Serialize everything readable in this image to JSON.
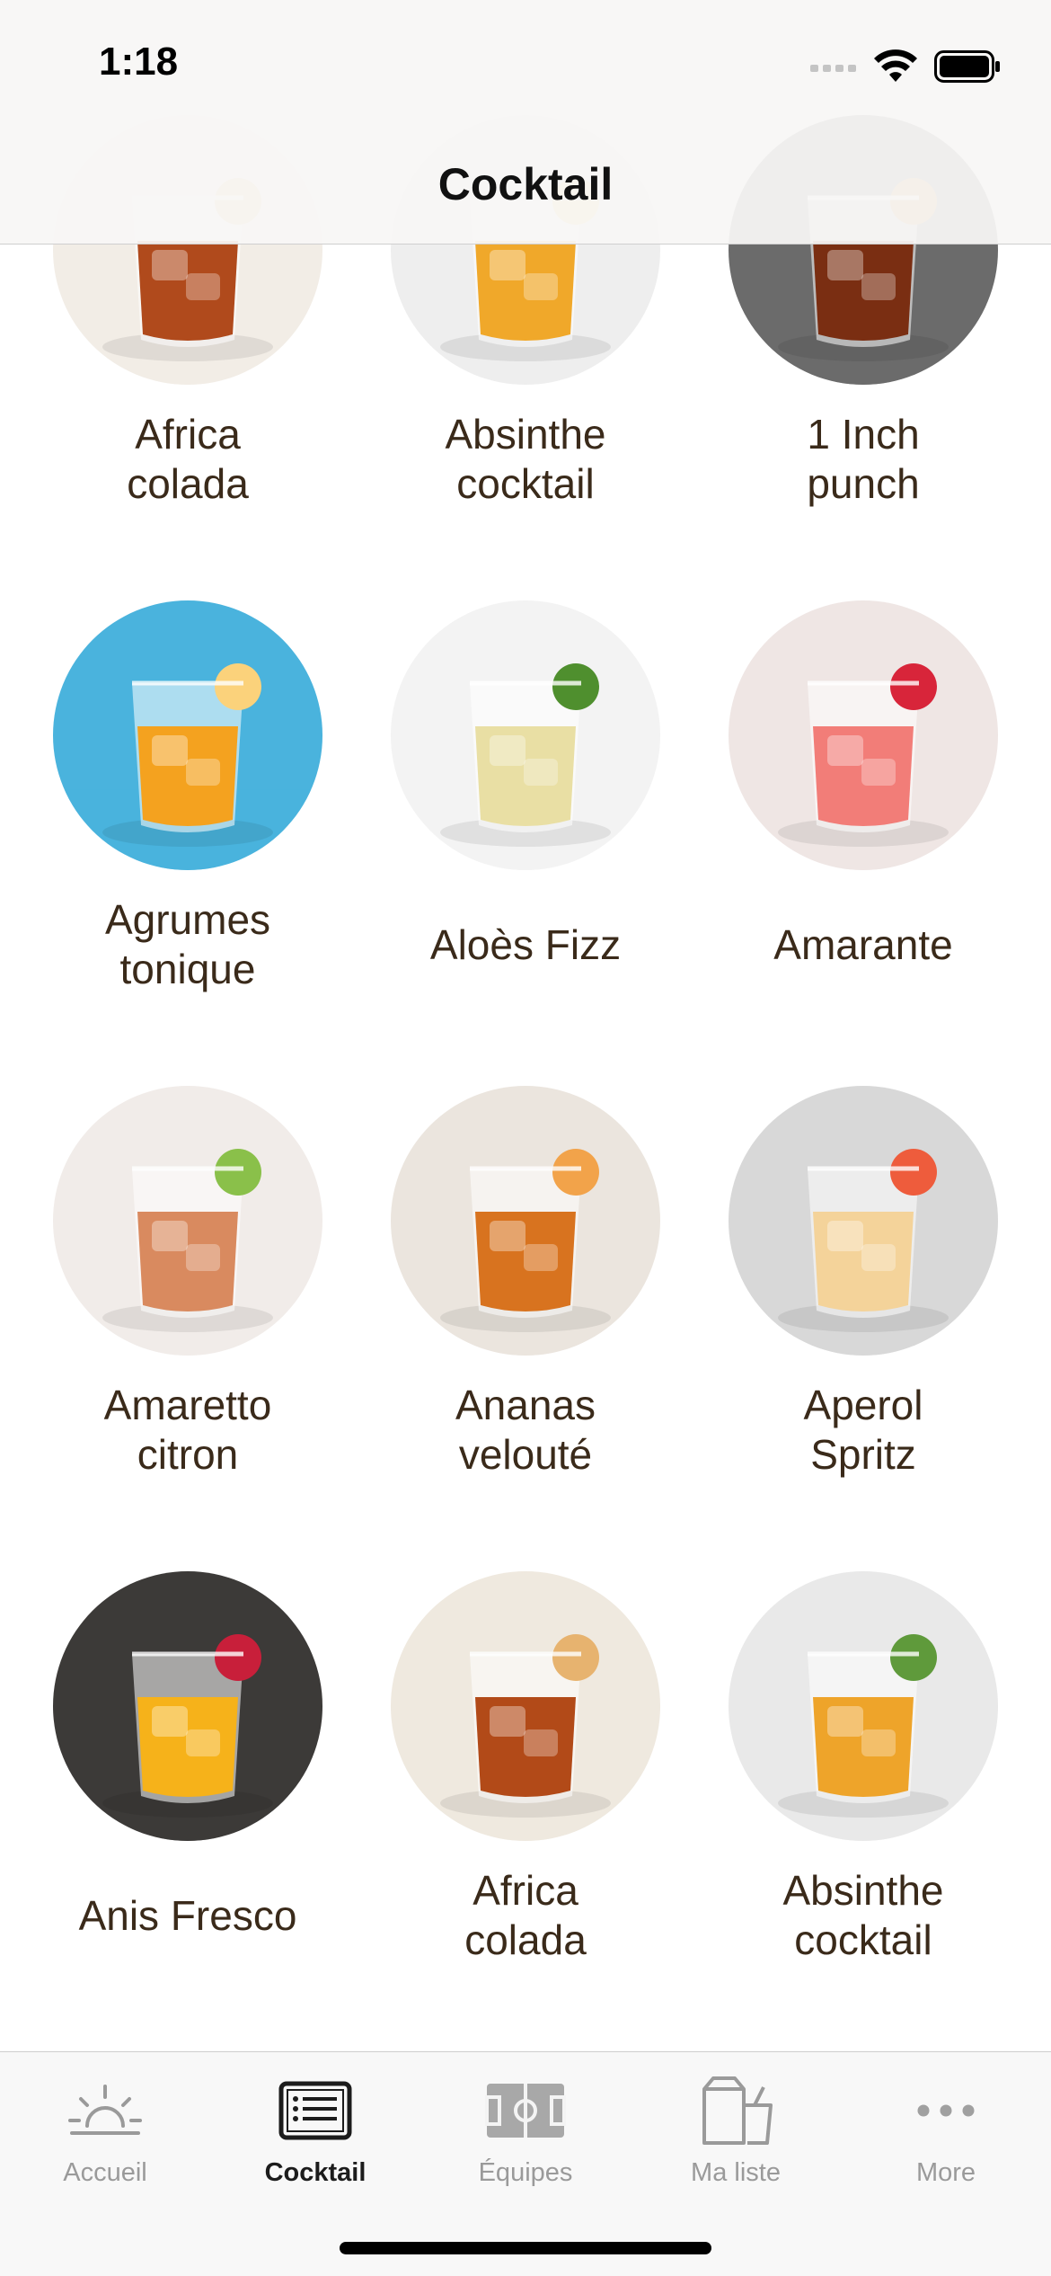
{
  "status_bar": {
    "time": "1:18"
  },
  "nav": {
    "title": "Cocktail"
  },
  "cocktails": [
    {
      "name": "Africa\ncolada",
      "palette": [
        "#f2ede6",
        "#b04a1c",
        "#e9c38a"
      ]
    },
    {
      "name": "Absinthe\ncocktail",
      "palette": [
        "#eeeeee",
        "#f0a82a",
        "#f7d27a"
      ]
    },
    {
      "name": "1 Inch\npunch",
      "palette": [
        "#6b6b6b",
        "#7a2e12",
        "#c9843a"
      ]
    },
    {
      "name": "Agrumes\ntonique",
      "palette": [
        "#4ab3dd",
        "#f4a21f",
        "#fbd27b"
      ]
    },
    {
      "name": "Aloès Fizz",
      "palette": [
        "#f3f3f3",
        "#e9dfa4",
        "#4f8f2e"
      ]
    },
    {
      "name": "Amarante",
      "palette": [
        "#efe6e4",
        "#f27d78",
        "#d8253a"
      ]
    },
    {
      "name": "Amaretto\ncitron",
      "palette": [
        "#f1ece9",
        "#d98a5f",
        "#8ac04a"
      ]
    },
    {
      "name": "Ananas\nvelouté",
      "palette": [
        "#ebe5de",
        "#d8731f",
        "#f2a34a"
      ]
    },
    {
      "name": "Aperol\nSpritz",
      "palette": [
        "#d8d8d8",
        "#f4d39a",
        "#ee5c3c"
      ]
    },
    {
      "name": "Anis Fresco",
      "palette": [
        "#3c3a38",
        "#f6b21a",
        "#c81f3a"
      ]
    },
    {
      "name": "Africa\ncolada",
      "palette": [
        "#efe9df",
        "#b24a18",
        "#e7b36f"
      ]
    },
    {
      "name": "Absinthe\ncocktail",
      "palette": [
        "#e9e9e9",
        "#eea42a",
        "#5f9a3b"
      ]
    }
  ],
  "tabbar": {
    "tabs": [
      {
        "label": "Accueil",
        "icon": "sunrise-icon",
        "active": false
      },
      {
        "label": "Cocktail",
        "icon": "menu-card-icon",
        "active": true
      },
      {
        "label": "Équipes",
        "icon": "field-icon",
        "active": false
      },
      {
        "label": "Ma liste",
        "icon": "shaker-icon",
        "active": false
      },
      {
        "label": "More",
        "icon": "more-icon",
        "active": false
      }
    ]
  },
  "colors": {
    "caption": "#3a2a1a",
    "tab_active": "#1c1c1c",
    "tab_inactive": "#9a9a9a"
  }
}
